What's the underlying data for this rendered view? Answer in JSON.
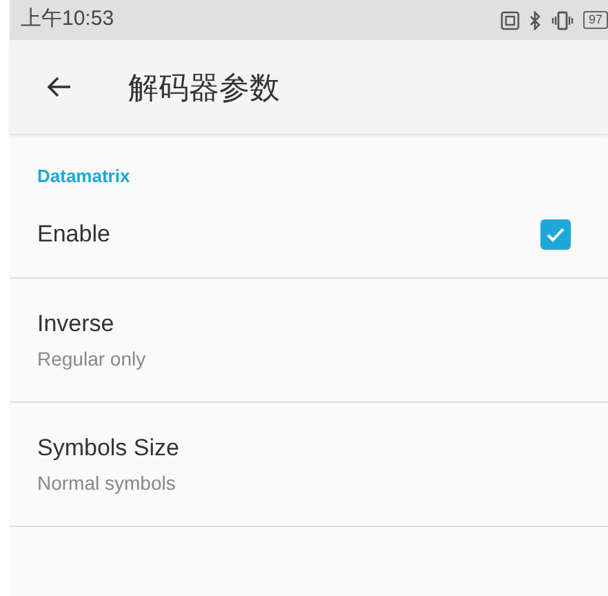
{
  "status_bar": {
    "time": "上午10:53",
    "battery": "97"
  },
  "toolbar": {
    "title": "解码器参数"
  },
  "section": {
    "title": "Datamatrix"
  },
  "items": [
    {
      "kind": "checkbox",
      "title": "Enable",
      "checked": true
    },
    {
      "kind": "text",
      "title": "Inverse",
      "summary": "Regular only"
    },
    {
      "kind": "text",
      "title": "Symbols Size",
      "summary": "Normal symbols"
    }
  ]
}
